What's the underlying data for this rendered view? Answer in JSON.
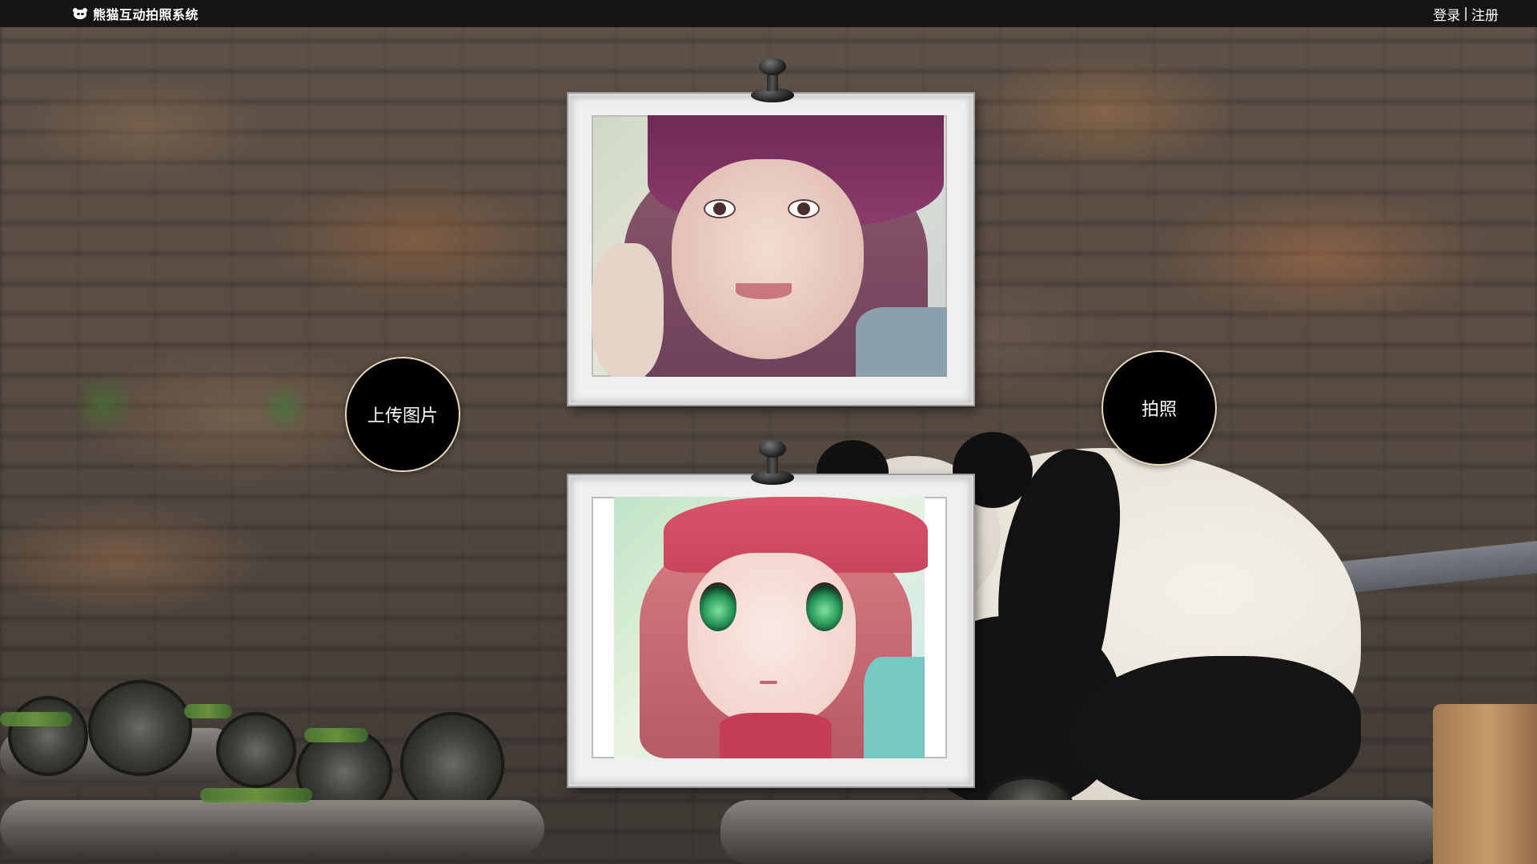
{
  "header": {
    "app_title": "熊猫互动拍照系统",
    "logo_icon": "panda-icon",
    "auth": {
      "login_label": "登录",
      "separator": "|",
      "register_label": "注册"
    }
  },
  "main": {
    "upload_button_label": "上传图片",
    "capture_button_label": "拍照",
    "photos": {
      "original": {
        "icon": "pushpin-icon"
      },
      "anime": {
        "icon": "pushpin-icon"
      }
    }
  },
  "colors": {
    "topbar": "#151515",
    "button_fill": "#000000",
    "button_border": "#e7d9b8",
    "frame": "#efefef"
  }
}
